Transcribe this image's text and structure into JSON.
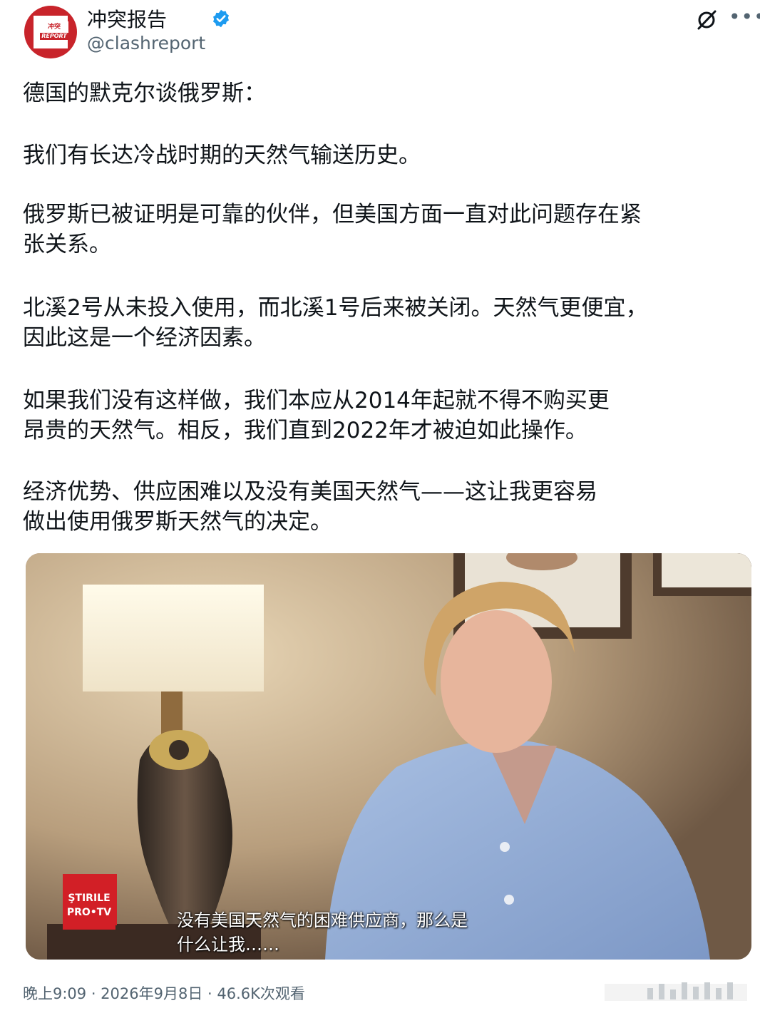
{
  "account": {
    "name": "冲突报告",
    "handle": "@clashreport",
    "avatar_text_top": "冲突",
    "avatar_text_bottom": "REPORT"
  },
  "icons": {
    "verified": "verified-badge-icon",
    "grok": "grok-icon",
    "more": "more-icon",
    "stats": "analytics-icon"
  },
  "post": {
    "paragraphs": [
      "德国的默克尔谈俄罗斯：",
      "我们有长达冷战时期的天然气输送历史。",
      "俄罗斯已被证明是可靠的伙伴，但美国方面一直对此问题存在紧\n张关系。",
      "北溪2号从未投入使用，而北溪1号后来被关闭。天然气更便宜，\n因此这是一个经济因素。",
      "如果我们没有这样做，我们本应从2014年起就不得不购买更\n昂贵的天然气。相反，我们直到2022年才被迫如此操作。",
      "经济优势、供应困难以及没有美国天然气——这让我更容易\n做出使用俄罗斯天然气的决定。"
    ]
  },
  "video": {
    "subtitle": "没有美国天然气的困难供应商，那么是\n什么让我……",
    "channel_logo_line1": "ŞTIRILE",
    "channel_logo_line2": "PRO•TV"
  },
  "footer": {
    "meta": "晚上9:09 · 2026年9月8日 · 46.6K次观看"
  },
  "colors": {
    "accent": "#1d9bf0",
    "avatar_red": "#c8242b",
    "muted_text": "#536471"
  }
}
